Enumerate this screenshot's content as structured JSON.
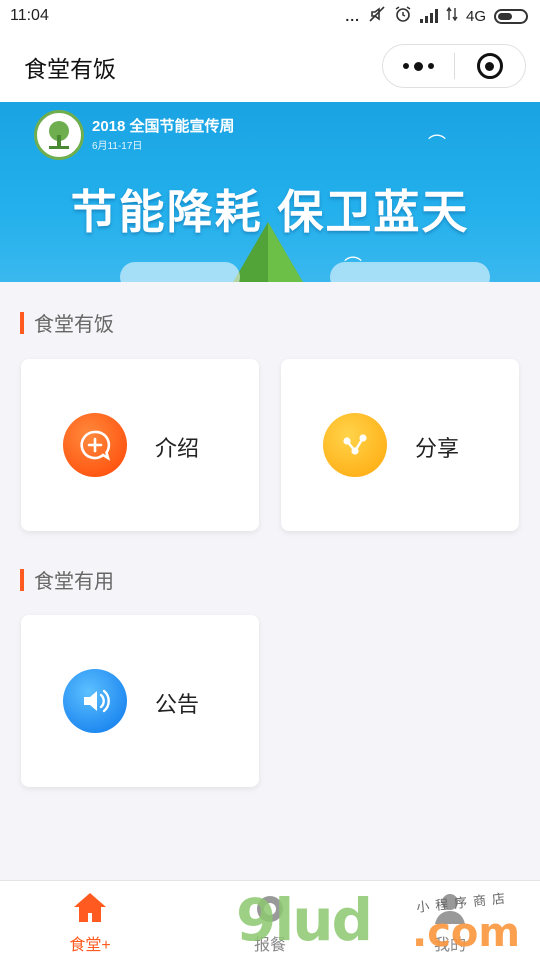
{
  "status_bar": {
    "time": "11:04",
    "dots": "...",
    "network": "4G"
  },
  "nav": {
    "title": "食堂有饭"
  },
  "banner": {
    "year_text": "2018 全国节能宣传周",
    "date_text": "6月11-17日",
    "slogan": "节能降耗 保卫蓝天"
  },
  "sections": [
    {
      "title": "食堂有饭",
      "cards": [
        {
          "label": "介绍",
          "icon": "chat-plus-icon",
          "color": "#ff5a1f"
        },
        {
          "label": "分享",
          "icon": "share-icon",
          "color": "#ffb21a"
        }
      ]
    },
    {
      "title": "食堂有用",
      "cards": [
        {
          "label": "公告",
          "icon": "speaker-icon",
          "color": "#1e88f0"
        }
      ]
    }
  ],
  "tabbar": {
    "items": [
      {
        "label": "食堂+",
        "icon": "home-icon",
        "active": true
      },
      {
        "label": "报餐",
        "icon": "order-icon",
        "active": false
      },
      {
        "label": "我的",
        "icon": "user-icon",
        "active": false
      }
    ]
  },
  "watermark": {
    "big": "9lud",
    "com": ".com",
    "small": "小程序商店"
  },
  "colors": {
    "accent": "#ff5a1f",
    "banner_blue": "#23b0ec"
  }
}
